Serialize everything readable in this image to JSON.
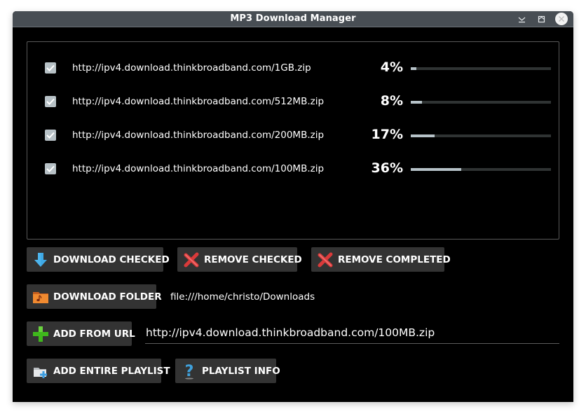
{
  "window": {
    "title": "MP3 Download Manager",
    "controls": {
      "minimize": "minimize",
      "maximize": "maximize",
      "close": "close"
    }
  },
  "downloads": [
    {
      "url": "http://ipv4.download.thinkbroadband.com/1GB.zip",
      "checked": true,
      "progress_label": "4%",
      "progress": 4
    },
    {
      "url": "http://ipv4.download.thinkbroadband.com/512MB.zip",
      "checked": true,
      "progress_label": "8%",
      "progress": 8
    },
    {
      "url": "http://ipv4.download.thinkbroadband.com/200MB.zip",
      "checked": true,
      "progress_label": "17%",
      "progress": 17
    },
    {
      "url": "http://ipv4.download.thinkbroadband.com/100MB.zip",
      "checked": true,
      "progress_label": "36%",
      "progress": 36
    }
  ],
  "buttons": {
    "download_checked": "DOWNLOAD CHECKED",
    "remove_checked": "REMOVE CHECKED",
    "remove_completed": "REMOVE COMPLETED",
    "download_folder": "DOWNLOAD FOLDER",
    "add_from_url": "ADD FROM URL",
    "add_entire_playlist": "ADD ENTIRE PLAYLIST",
    "playlist_info": "PLAYLIST INFO"
  },
  "download_folder_path": "file:///home/christo/Downloads",
  "url_input": {
    "value": "http://ipv4.download.thinkbroadband.com/100MB.zip"
  },
  "colors": {
    "titlebar": "#484e54",
    "background": "#000000",
    "button": "#333333",
    "progress_fill": "#b6c2c8",
    "progress_track": "#2f3333",
    "checkbox": "#b7c1c6"
  }
}
